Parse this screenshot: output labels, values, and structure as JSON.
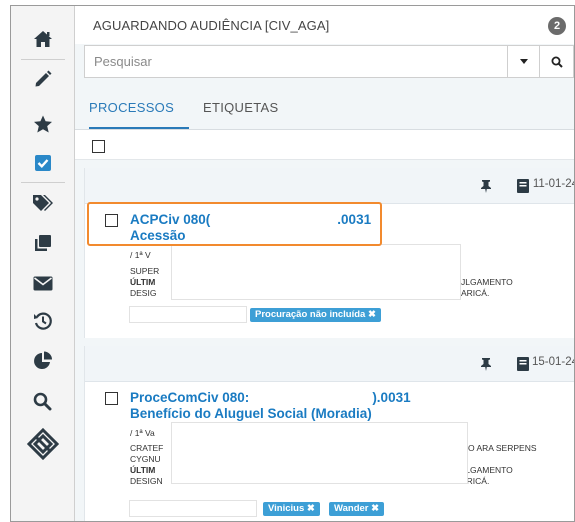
{
  "header": {
    "title": "AGUARDANDO AUDIÊNCIA [CIV_AGA]",
    "count": "2"
  },
  "search": {
    "placeholder": "Pesquisar"
  },
  "tabs": [
    {
      "label": "PROCESSOS",
      "active": true
    },
    {
      "label": "ETIQUETAS",
      "active": false
    }
  ],
  "sidebar": {
    "items": [
      {
        "icon": "home-icon"
      },
      {
        "icon": "pencil-icon"
      },
      {
        "icon": "star-icon"
      },
      {
        "icon": "checkbox-icon"
      },
      {
        "icon": "tags-icon"
      },
      {
        "icon": "copy-icon"
      },
      {
        "icon": "envelope-icon"
      },
      {
        "icon": "history-icon"
      },
      {
        "icon": "pie-chart-icon"
      },
      {
        "icon": "search-icon"
      },
      {
        "icon": "pje-logo-icon"
      }
    ]
  },
  "cards": [
    {
      "date": "11-01-24",
      "title_left": "ACPCiv 080(",
      "title_right": ".0031",
      "subject": "Acessão",
      "lines": [
        "/ 1ª V",
        "SUPER",
        "ÚLTIM",
        "DESIG"
      ],
      "lines_right": [
        "JLGAMENTO",
        "ARICÁ."
      ],
      "tags": [
        "Procuração não incluída ✖"
      ]
    },
    {
      "date": "15-01-24",
      "title_left": "ProceComCiv 080:",
      "title_right": ").0031",
      "subject": "Benefício do Aluguel Social (Moradia)",
      "lines": [
        "/ 1ª Va",
        "CRATEF",
        "CYGNU",
        "ÚLTIM",
        "DESIGN"
      ],
      "lines_right": [
        "O ARA SERPENS",
        "JLGAMENTO",
        "ARICÁ."
      ],
      "tags": [
        "Vinicius ✖",
        "Wander ✖"
      ]
    }
  ],
  "colors": {
    "accent": "#2a7ab8",
    "link": "#1a7bc2",
    "tag": "#3d9fd6",
    "highlight": "#f28a2e",
    "sidebar_icon": "#2d3b45",
    "check": "#2a88c8"
  }
}
